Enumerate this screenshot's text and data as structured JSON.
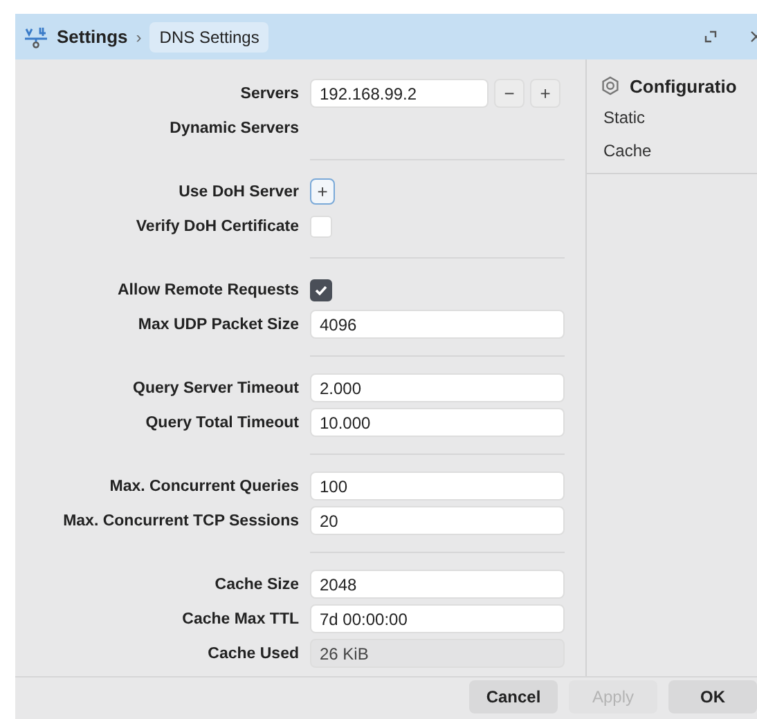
{
  "breadcrumb": {
    "root": "Settings",
    "separator": "›",
    "current": "DNS Settings"
  },
  "groups": [
    [
      {
        "label": "Servers",
        "kind": "list",
        "value": "192.168.99.2",
        "remove": "−",
        "add": "+"
      },
      {
        "label": "Dynamic Servers",
        "kind": "none"
      }
    ],
    [
      {
        "label": "Use DoH Server",
        "kind": "add",
        "add": "+"
      },
      {
        "label": "Verify DoH Certificate",
        "kind": "checkbox",
        "checked": false
      }
    ],
    [
      {
        "label": "Allow Remote Requests",
        "kind": "checkbox",
        "checked": true
      },
      {
        "label": "Max UDP Packet Size",
        "kind": "text",
        "value": "4096"
      }
    ],
    [
      {
        "label": "Query Server Timeout",
        "kind": "text",
        "value": "2.000"
      },
      {
        "label": "Query Total Timeout",
        "kind": "text",
        "value": "10.000"
      }
    ],
    [
      {
        "label": "Max. Concurrent Queries",
        "kind": "text",
        "value": "100"
      },
      {
        "label": "Max. Concurrent TCP Sessions",
        "kind": "text",
        "value": "20"
      }
    ],
    [
      {
        "label": "Cache Size",
        "kind": "text",
        "value": "2048"
      },
      {
        "label": "Cache Max TTL",
        "kind": "text",
        "value": "7d 00:00:00"
      },
      {
        "label": "Cache Used",
        "kind": "readonly",
        "value": "26 KiB"
      }
    ]
  ],
  "sidebar": {
    "title": "Configuratio",
    "items": [
      {
        "label": "Static"
      },
      {
        "label": "Cache"
      }
    ]
  },
  "buttons": [
    {
      "label": "Cancel",
      "disabled": false
    },
    {
      "label": "Apply",
      "disabled": true
    },
    {
      "label": "OK",
      "disabled": false
    }
  ]
}
